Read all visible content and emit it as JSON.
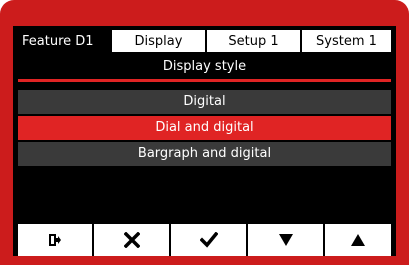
{
  "tabs": [
    {
      "label": "Feature  D1",
      "active": true
    },
    {
      "label": "Display",
      "active": false
    },
    {
      "label": "Setup 1",
      "active": false
    },
    {
      "label": "System 1",
      "active": false
    }
  ],
  "subtitle": "Display style",
  "options": [
    {
      "label": "Digital",
      "selected": false
    },
    {
      "label": "Dial and digital",
      "selected": true
    },
    {
      "label": "Bargraph and digital",
      "selected": false
    }
  ],
  "softkeys": [
    {
      "icon": "exit-icon"
    },
    {
      "icon": "cross-icon"
    },
    {
      "icon": "checkmark-icon"
    },
    {
      "icon": "down-triangle-icon"
    },
    {
      "icon": "up-triangle-icon"
    }
  ],
  "colors": {
    "accent": "#e02424",
    "frame": "#cc1c1c",
    "row": "#3a3a3a",
    "screen": "#000000"
  }
}
